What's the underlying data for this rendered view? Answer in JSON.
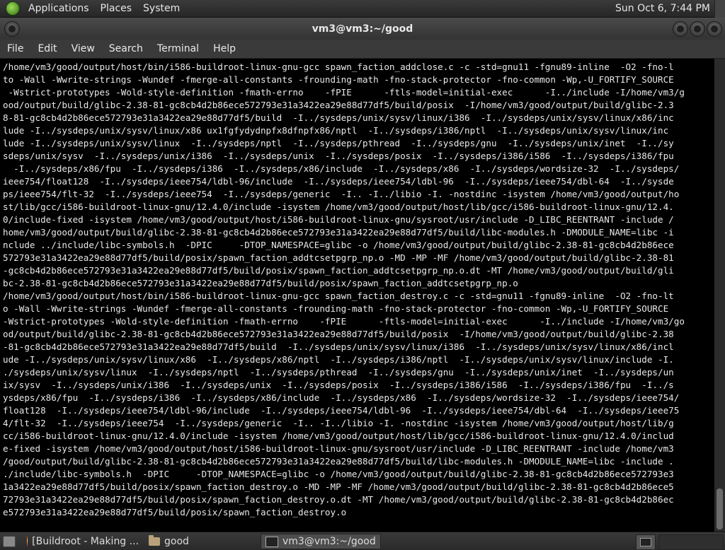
{
  "top_panel": {
    "menus": [
      "Applications",
      "Places",
      "System"
    ],
    "clock": "Sun Oct  6,  7:44 PM"
  },
  "window": {
    "title": "vm3@vm3:~/good"
  },
  "menu_bar": {
    "items": [
      "File",
      "Edit",
      "View",
      "Search",
      "Terminal",
      "Help"
    ]
  },
  "terminal": {
    "lines": [
      "/home/vm3/good/output/host/bin/i586-buildroot-linux-gnu-gcc spawn_faction_addclose.c -c -std=gnu11 -fgnu89-inline  -O2 -fno-l",
      "to -Wall -Wwrite-strings -Wundef -fmerge-all-constants -frounding-math -fno-stack-protector -fno-common -Wp,-U_FORTIFY_SOURCE",
      " -Wstrict-prototypes -Wold-style-definition -fmath-errno    -fPIE      -ftls-model=initial-exec      -I../include -I/home/vm3/g",
      "ood/output/build/glibc-2.38-81-gc8cb4d2b86ece572793e31a3422ea29e88d77df5/build/posix  -I/home/vm3/good/output/build/glibc-2.3",
      "8-81-gc8cb4d2b86ece572793e31a3422ea29e88d77df5/build  -I../sysdeps/unix/sysv/linux/i386  -I../sysdeps/unix/sysv/linux/x86/inc",
      "lude -I../sysdeps/unix/sysv/linux/x86 ux1fgfydydnpfx8dfnpfx86/nptl  -I../sysdeps/i386/nptl  -I../sysdeps/unix/sysv/linux/inc",
      "lude -I../sysdeps/unix/sysv/linux  -I../sysdeps/nptl  -I../sysdeps/pthread  -I../sysdeps/gnu  -I../sysdeps/unix/inet  -I../sy",
      "sdeps/unix/sysv  -I../sysdeps/unix/i386  -I../sysdeps/unix  -I../sysdeps/posix  -I../sysdeps/i386/i586  -I../sysdeps/i386/fpu",
      "  -I../sysdeps/x86/fpu  -I../sysdeps/i386  -I../sysdeps/x86/include  -I../sysdeps/x86  -I../sysdeps/wordsize-32  -I../sysdeps/",
      "ieee754/float128  -I../sysdeps/ieee754/ldbl-96/include  -I../sysdeps/ieee754/ldbl-96  -I../sysdeps/ieee754/dbl-64  -I../sysde",
      "ps/ieee754/flt-32  -I../sysdeps/ieee754  -I../sysdeps/generic  -I.. -I../libio -I. -nostdinc -isystem /home/vm3/good/output/ho",
      "st/lib/gcc/i586-buildroot-linux-gnu/12.4.0/include -isystem /home/vm3/good/output/host/lib/gcc/i586-buildroot-linux-gnu/12.4.",
      "0/include-fixed -isystem /home/vm3/good/output/host/i586-buildroot-linux-gnu/sysroot/usr/include -D_LIBC_REENTRANT -include /",
      "home/vm3/good/output/build/glibc-2.38-81-gc8cb4d2b86ece572793e31a3422ea29e88d77df5/build/libc-modules.h -DMODULE_NAME=libc -i",
      "nclude ../include/libc-symbols.h  -DPIC     -DTOP_NAMESPACE=glibc -o /home/vm3/good/output/build/glibc-2.38-81-gc8cb4d2b86ece",
      "572793e31a3422ea29e88d77df5/build/posix/spawn_faction_addtcsetpgrp_np.o -MD -MP -MF /home/vm3/good/output/build/glibc-2.38-81",
      "-gc8cb4d2b86ece572793e31a3422ea29e88d77df5/build/posix/spawn_faction_addtcsetpgrp_np.o.dt -MT /home/vm3/good/output/build/gli",
      "bc-2.38-81-gc8cb4d2b86ece572793e31a3422ea29e88d77df5/build/posix/spawn_faction_addtcsetpgrp_np.o",
      "/home/vm3/good/output/host/bin/i586-buildroot-linux-gnu-gcc spawn_faction_destroy.c -c -std=gnu11 -fgnu89-inline  -O2 -fno-lt",
      "o -Wall -Wwrite-strings -Wundef -fmerge-all-constants -frounding-math -fno-stack-protector -fno-common -Wp,-U_FORTIFY_SOURCE ",
      "-Wstrict-prototypes -Wold-style-definition -fmath-errno    -fPIE      -ftls-model=initial-exec      -I../include -I/home/vm3/go",
      "od/output/build/glibc-2.38-81-gc8cb4d2b86ece572793e31a3422ea29e88d77df5/build/posix  -I/home/vm3/good/output/build/glibc-2.38",
      "-81-gc8cb4d2b86ece572793e31a3422ea29e88d77df5/build  -I../sysdeps/unix/sysv/linux/i386  -I../sysdeps/unix/sysv/linux/x86/incl",
      "ude -I../sysdeps/unix/sysv/linux/x86  -I../sysdeps/x86/nptl  -I../sysdeps/i386/nptl  -I../sysdeps/unix/sysv/linux/include -I.",
      "./sysdeps/unix/sysv/linux  -I../sysdeps/nptl  -I../sysdeps/pthread  -I../sysdeps/gnu  -I../sysdeps/unix/inet  -I../sysdeps/un",
      "ix/sysv  -I../sysdeps/unix/i386  -I../sysdeps/unix  -I../sysdeps/posix  -I../sysdeps/i386/i586  -I../sysdeps/i386/fpu  -I../s",
      "ysdeps/x86/fpu  -I../sysdeps/i386  -I../sysdeps/x86/include  -I../sysdeps/x86  -I../sysdeps/wordsize-32  -I../sysdeps/ieee754/",
      "float128  -I../sysdeps/ieee754/ldbl-96/include  -I../sysdeps/ieee754/ldbl-96  -I../sysdeps/ieee754/dbl-64  -I../sysdeps/ieee75",
      "4/flt-32  -I../sysdeps/ieee754  -I../sysdeps/generic  -I.. -I../libio -I. -nostdinc -isystem /home/vm3/good/output/host/lib/g",
      "cc/i586-buildroot-linux-gnu/12.4.0/include -isystem /home/vm3/good/output/host/lib/gcc/i586-buildroot-linux-gnu/12.4.0/includ",
      "e-fixed -isystem /home/vm3/good/output/host/i586-buildroot-linux-gnu/sysroot/usr/include -D_LIBC_REENTRANT -include /home/vm3",
      "/good/output/build/glibc-2.38-81-gc8cb4d2b86ece572793e31a3422ea29e88d77df5/build/libc-modules.h -DMODULE_NAME=libc -include .",
      "./include/libc-symbols.h  -DPIC     -DTOP_NAMESPACE=glibc -o /home/vm3/good/output/build/glibc-2.38-81-gc8cb4d2b86ece572793e3",
      "1a3422ea29e88d77df5/build/posix/spawn_faction_destroy.o -MD -MP -MF /home/vm3/good/output/build/glibc-2.38-81-gc8cb4d2b86ece5",
      "72793e31a3422ea29e88d77df5/build/posix/spawn_faction_destroy.o.dt -MT /home/vm3/good/output/build/glibc-2.38-81-gc8cb4d2b86ec",
      "e572793e31a3422ea29e88d77df5/build/posix/spawn_faction_destroy.o"
    ]
  },
  "taskbar": {
    "items": [
      {
        "label": "[Buildroot - Making ...",
        "icon": "firefox-icon"
      },
      {
        "label": "good",
        "icon": "folder-icon"
      },
      {
        "label": "vm3@vm3:~/good",
        "icon": "terminal-icon"
      }
    ]
  }
}
